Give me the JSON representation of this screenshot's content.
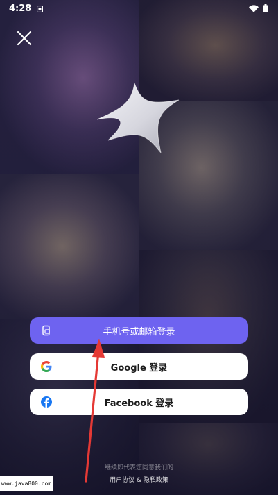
{
  "status_bar": {
    "time": "4:28",
    "icons": [
      "sim-card-icon",
      "wifi-icon",
      "battery-icon"
    ]
  },
  "close_icon": "close-icon",
  "logo_icon": "sparkle-star-icon",
  "buttons": {
    "phone_email": {
      "label": "手机号或邮箱登录",
      "icon": "phone-icon",
      "color": "#6e63f0"
    },
    "google": {
      "label": "Google 登录",
      "icon": "google-icon"
    },
    "facebook": {
      "label": "Facebook 登录",
      "icon": "facebook-icon",
      "color": "#1877f2"
    }
  },
  "consent": {
    "line": "继续即代表您同意我们的",
    "links": "用户协议 & 隐私政策"
  },
  "watermark": "www.java800.com",
  "annotation": {
    "arrow_color": "#e53935"
  }
}
